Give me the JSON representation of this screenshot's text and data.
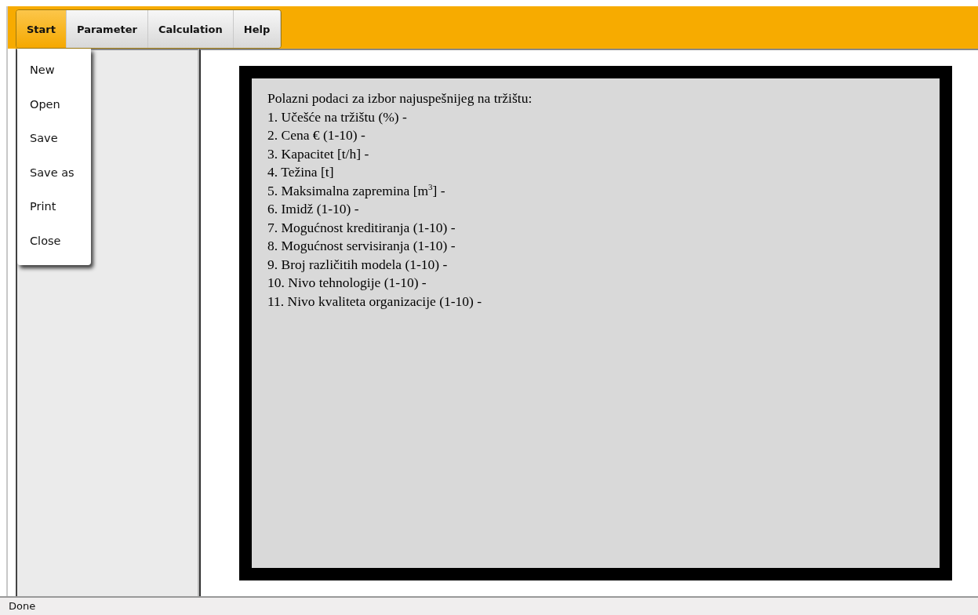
{
  "menu_bar": {
    "tabs": [
      {
        "label": "Start",
        "selected": true
      },
      {
        "label": "Parameter",
        "selected": false
      },
      {
        "label": "Calculation",
        "selected": false
      },
      {
        "label": "Help",
        "selected": false
      }
    ]
  },
  "dropdown": {
    "items": [
      "New",
      "Open",
      "Save",
      "Save as",
      "Print",
      "Close"
    ]
  },
  "document": {
    "lines": [
      "Polazni podaci za izbor najuspešnijeg na tržištu:",
      "1. Učešće na tržištu (%) -",
      "2. Cena € (1-10) -",
      "3. Kapacitet [t/h] -",
      "4. Težina [t]",
      "5. Maksimalna zapremina [m$^{3}$] -",
      "6. Imidž (1-10) -",
      "7. Mogućnost kreditiranja (1-10) -",
      "8. Mogućnost servisiranja (1-10) -",
      "9. Broj različitih modela (1-10) -",
      "10. Nivo tehnologije (1-10) -",
      "11. Nivo kvaliteta organizacije (1-10) -"
    ]
  },
  "status_bar": "Done"
}
